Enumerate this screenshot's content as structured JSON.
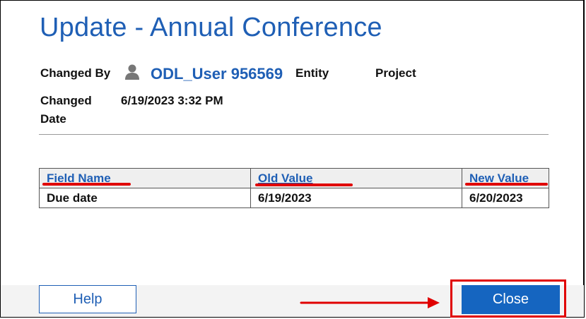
{
  "dialog": {
    "title": "Update - Annual Conference"
  },
  "details": {
    "changed_by_label": "Changed By",
    "user_name": "ODL_User 956569",
    "entity_label": "Entity",
    "project_label": "Project",
    "changed_date_label_line1": "Changed",
    "changed_date_label_line2": "Date",
    "changed_date_value": "6/19/2023 3:32 PM"
  },
  "table": {
    "headers": [
      "Field Name",
      "Old Value",
      "New Value"
    ],
    "rows": [
      [
        "Due date",
        "6/19/2023",
        "6/20/2023"
      ]
    ]
  },
  "footer": {
    "help_label": "Help",
    "close_label": "Close"
  },
  "icons": {
    "user": "user-icon",
    "arrow": "arrow-right-icon"
  },
  "colors": {
    "accent": "#1f5fb5",
    "primary_button": "#1565c0",
    "annotation": "#e00000"
  }
}
